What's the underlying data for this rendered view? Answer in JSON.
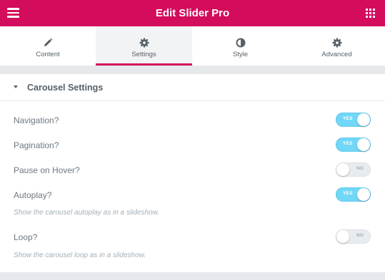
{
  "header": {
    "title": "Edit Slider Pro",
    "menu_icon": "hamburger-menu-icon",
    "apps_icon": "grid-apps-icon",
    "background_color": "#d30c5c"
  },
  "tabs": [
    {
      "label": "Content",
      "icon": "pencil-icon",
      "active": false
    },
    {
      "label": "Settings",
      "icon": "gear-icon",
      "active": true
    },
    {
      "label": "Style",
      "icon": "half-circle-contrast-icon",
      "active": false
    },
    {
      "label": "Advanced",
      "icon": "gear-icon",
      "active": false
    }
  ],
  "section": {
    "title": "Carousel Settings",
    "expanded": true,
    "controls": [
      {
        "label": "Navigation?",
        "value": "YES",
        "on": true
      },
      {
        "label": "Pagination?",
        "value": "YES",
        "on": true
      },
      {
        "label": "Pause on Hover?",
        "value": "NO",
        "on": false
      },
      {
        "label": "Autoplay?",
        "value": "YES",
        "on": true,
        "description": "Show the carousel autoplay as in a slideshow."
      },
      {
        "label": "Loop?",
        "value": "NO",
        "on": false,
        "description": "Show the carousel loop as in a slideshow."
      }
    ]
  },
  "colors": {
    "accent": "#d30c5c",
    "switch_on": "#71d7f7",
    "switch_off": "#e9ecef"
  }
}
